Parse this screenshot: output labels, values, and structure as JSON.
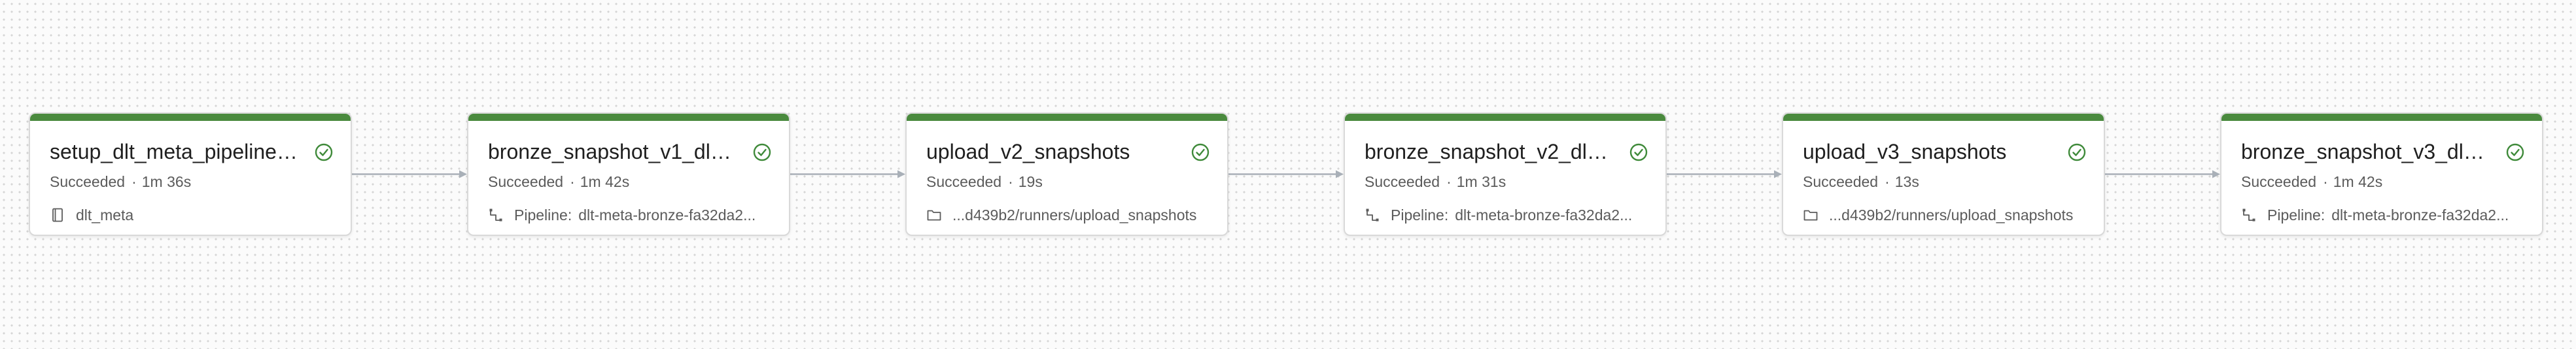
{
  "tasks": [
    {
      "title": "setup_dlt_meta_pipeline_s...",
      "status": "Succeeded",
      "duration": "1m 36s",
      "resource_icon": "notebook-icon",
      "resource_prefix": "",
      "resource": "dlt_meta"
    },
    {
      "title": "bronze_snapshot_v1_dlt_p...",
      "status": "Succeeded",
      "duration": "1m 42s",
      "resource_icon": "pipeline-icon",
      "resource_prefix": "Pipeline:",
      "resource": "dlt-meta-bronze-fa32da2..."
    },
    {
      "title": "upload_v2_snapshots",
      "status": "Succeeded",
      "duration": "19s",
      "resource_icon": "folder-icon",
      "resource_prefix": "",
      "resource": "...d439b2/runners/upload_snapshots"
    },
    {
      "title": "bronze_snapshot_v2_dlt_...",
      "status": "Succeeded",
      "duration": "1m 31s",
      "resource_icon": "pipeline-icon",
      "resource_prefix": "Pipeline:",
      "resource": "dlt-meta-bronze-fa32da2..."
    },
    {
      "title": "upload_v3_snapshots",
      "status": "Succeeded",
      "duration": "13s",
      "resource_icon": "folder-icon",
      "resource_prefix": "",
      "resource": "...d439b2/runners/upload_snapshots"
    },
    {
      "title": "bronze_snapshot_v3_dlt_...",
      "status": "Succeeded",
      "duration": "1m 42s",
      "resource_icon": "pipeline-icon",
      "resource_prefix": "Pipeline:",
      "resource": "dlt-meta-bronze-fa32da2..."
    }
  ],
  "separator": "·",
  "colors": {
    "status_bar": "#4a8a3e",
    "success_icon": "#3f8a3a",
    "edge": "#a9b0b8",
    "background": "#fbfbfb"
  }
}
